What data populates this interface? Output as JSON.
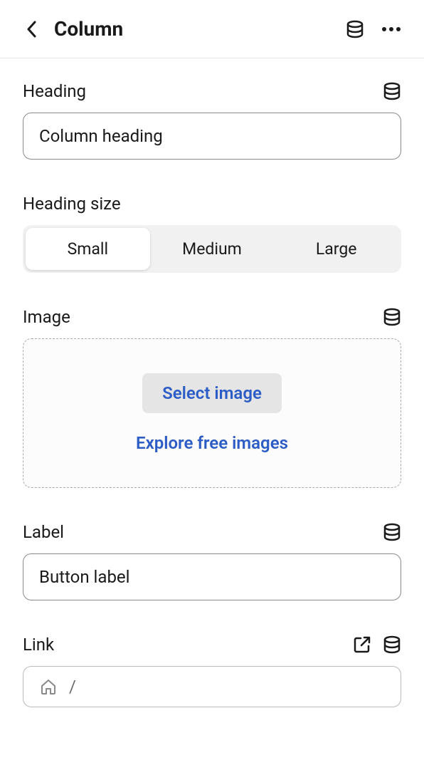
{
  "header": {
    "title": "Column"
  },
  "sections": {
    "heading": {
      "label": "Heading",
      "value": "Column heading"
    },
    "headingSize": {
      "label": "Heading size",
      "options": [
        "Small",
        "Medium",
        "Large"
      ],
      "selected": "Small"
    },
    "image": {
      "label": "Image",
      "selectButton": "Select image",
      "exploreLink": "Explore free images"
    },
    "labelField": {
      "label": "Label",
      "value": "Button label"
    },
    "link": {
      "label": "Link",
      "value": "/"
    }
  }
}
